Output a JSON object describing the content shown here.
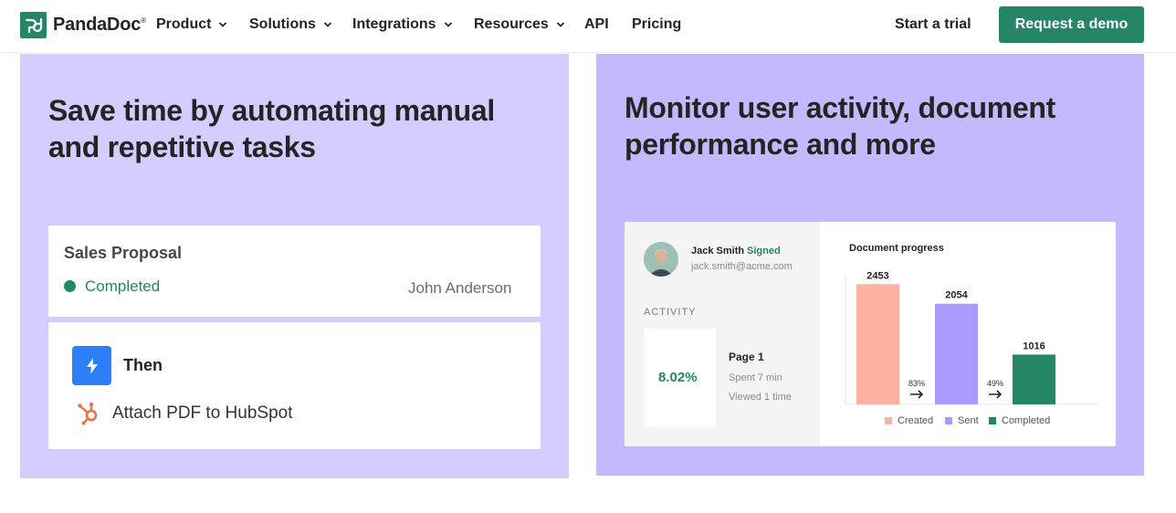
{
  "nav": {
    "brand": "PandaDoc",
    "brand_mark": "®",
    "items": [
      {
        "label": "Product",
        "dropdown": true
      },
      {
        "label": "Solutions",
        "dropdown": true
      },
      {
        "label": "Integrations",
        "dropdown": true
      },
      {
        "label": "Resources",
        "dropdown": true
      },
      {
        "label": "API",
        "dropdown": false
      },
      {
        "label": "Pricing",
        "dropdown": false
      }
    ],
    "start_trial": "Start a trial",
    "request_demo": "Request a demo"
  },
  "left_card": {
    "title_line1": "Save time by automating manual",
    "title_line2": "and repetitive tasks",
    "proposal": {
      "title": "Sales Proposal",
      "status": "Completed",
      "owner": "John Anderson"
    },
    "automation": {
      "then_label": "Then",
      "action_label": "Attach PDF to HubSpot"
    }
  },
  "right_card": {
    "title_line1": "Monitor user activity, document",
    "title_line2": "performance and more",
    "user": {
      "name": "Jack Smith",
      "status": "Signed",
      "email": "jack.smith@acme.com"
    },
    "activity": {
      "label": "ACTIVITY",
      "percent": "8.02%",
      "page": "Page 1",
      "spent": "Spent 7 min",
      "viewed": "Viewed 1 time"
    }
  },
  "chart_data": {
    "type": "bar",
    "title": "Document progress",
    "categories": [
      "Created",
      "Sent",
      "Completed"
    ],
    "values": [
      2453,
      2054,
      1016
    ],
    "colors": [
      "#fcb1a3",
      "#a99afe",
      "#248567"
    ],
    "conversion_labels": [
      "83%",
      "49%"
    ],
    "ylim": [
      0,
      2700
    ],
    "legend_position": "bottom"
  },
  "colors": {
    "brand_green": "#248567",
    "left_card_bg": "#d6ccfe",
    "right_card_bg": "#c5b8fd"
  }
}
